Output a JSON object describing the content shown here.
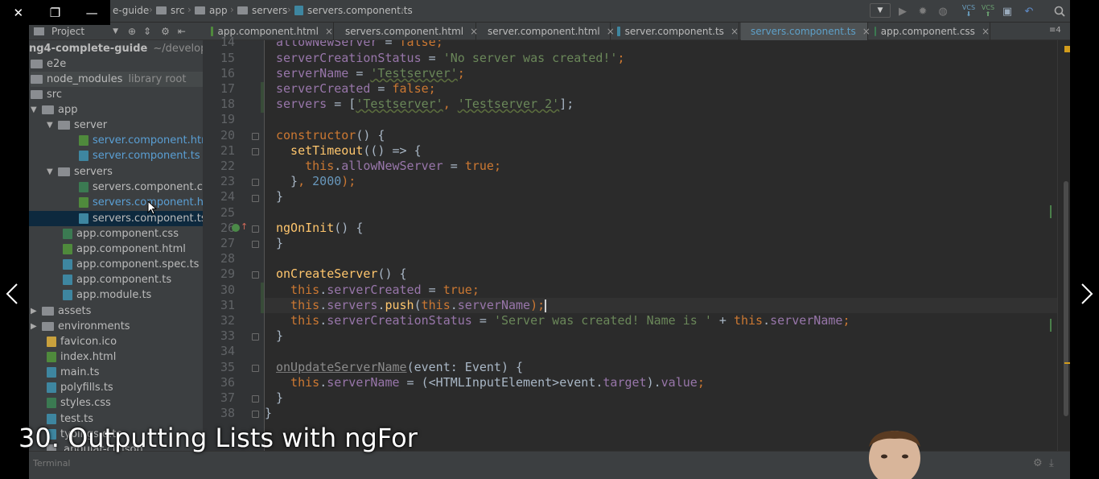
{
  "window_controls": {
    "close_icon": "✕",
    "restore_icon": "❐",
    "minimize_icon": "—"
  },
  "breadcrumb": [
    "e-guide",
    "src",
    "app",
    "servers",
    "servers.component.ts"
  ],
  "project_panel": {
    "label": "Project"
  },
  "tabs": [
    {
      "label": "app.component.html",
      "type": "html"
    },
    {
      "label": "servers.component.html",
      "type": "html"
    },
    {
      "label": "server.component.html",
      "type": "html"
    },
    {
      "label": "server.component.ts",
      "type": "ts"
    },
    {
      "label": "servers.component.ts",
      "type": "ts",
      "active": true
    },
    {
      "label": "app.component.css",
      "type": "css"
    }
  ],
  "tab_overflow": "4",
  "tree": {
    "root": "ng4-complete-guide",
    "root_hint": "~/developme",
    "items": [
      "e2e",
      "node_modules",
      "src",
      "app",
      "server",
      "server.component.htm",
      "server.component.ts",
      "servers",
      "servers.component.cs",
      "servers.component.html",
      "servers.component.ts",
      "app.component.css",
      "app.component.html",
      "app.component.spec.ts",
      "app.component.ts",
      "app.module.ts",
      "assets",
      "environments",
      "favicon.ico",
      "index.html",
      "main.ts",
      "polyfills.ts",
      "styles.css",
      "test.ts",
      "typings.d.ts",
      ".angular-cli.json"
    ],
    "library_root_hint": "library root"
  },
  "line_numbers": [
    "14",
    "15",
    "16",
    "17",
    "18",
    "19",
    "20",
    "21",
    "22",
    "23",
    "24",
    "25",
    "26",
    "27",
    "28",
    "29",
    "30",
    "31",
    "32",
    "33",
    "34",
    "35",
    "36",
    "37",
    "38"
  ],
  "code": {
    "l14a": "allowNewServer",
    "l14b": " = ",
    "l14c": "false",
    "l14d": ";",
    "l15a": "serverCreationStatus",
    "l15b": " = ",
    "l15c": "'No server was created!'",
    "l15d": ";",
    "l16a": "serverName",
    "l16b": " = ",
    "l16c": "'Testserver'",
    "l16d": ";",
    "l17a": "serverCreated",
    "l17b": " = ",
    "l17c": "false",
    "l17d": ";",
    "l18a": "servers",
    "l18b": " = [",
    "l18c": "'Testserver'",
    "l18d": ", ",
    "l18e": "'Testserver 2'",
    "l18f": "];",
    "l20a": "constructor",
    "l20b": "() {",
    "l21a": "  setTimeout",
    "l21b": "(() => {",
    "l22a": "    this",
    "l22b": ".",
    "l22c": "allowNewServer",
    "l22d": " = ",
    "l22e": "true",
    "l22f": ";",
    "l23a": "  }",
    "l23b": ", ",
    "l23c": "2000",
    "l23d": ");",
    "l24a": "}",
    "l26a": "ngOnInit",
    "l26b": "() {",
    "l27a": "}",
    "l29a": "onCreateServer",
    "l29b": "() {",
    "l30a": "  this",
    "l30b": ".",
    "l30c": "serverCreated",
    "l30d": " = ",
    "l30e": "true",
    "l30f": ";",
    "l31a": "  this",
    "l31b": ".",
    "l31c": "servers",
    "l31d": ".",
    "l31e": "push",
    "l31f": "(",
    "l31g": "this",
    "l31h": ".",
    "l31i": "serverName",
    "l31j": ");",
    "l32a": "  this",
    "l32b": ".",
    "l32c": "serverCreationStatus",
    "l32d": " = ",
    "l32e": "'Server was created! Name is '",
    "l32f": " + ",
    "l32g": "this",
    "l32h": ".",
    "l32i": "serverName",
    "l32j": ";",
    "l33a": "}",
    "l35a": "onUpdateServerName",
    "l35b": "(event: Event) {",
    "l36a": "  this",
    "l36b": ".",
    "l36c": "serverName",
    "l36d": " = (<HTMLInputElement>event.",
    "l36e": "target",
    "l36f": ").",
    "l36g": "value",
    "l36h": ";",
    "l37a": "}",
    "l38a": "}"
  },
  "bottom_panel": {
    "label": "Terminal"
  },
  "caption": "30. Outputting Lists with ngFor",
  "colors": {
    "keyword": "#cc7832",
    "string": "#6a8759",
    "property": "#9876aa",
    "function": "#ffc66d",
    "number": "#6897bb",
    "background": "#2b2b2b"
  }
}
